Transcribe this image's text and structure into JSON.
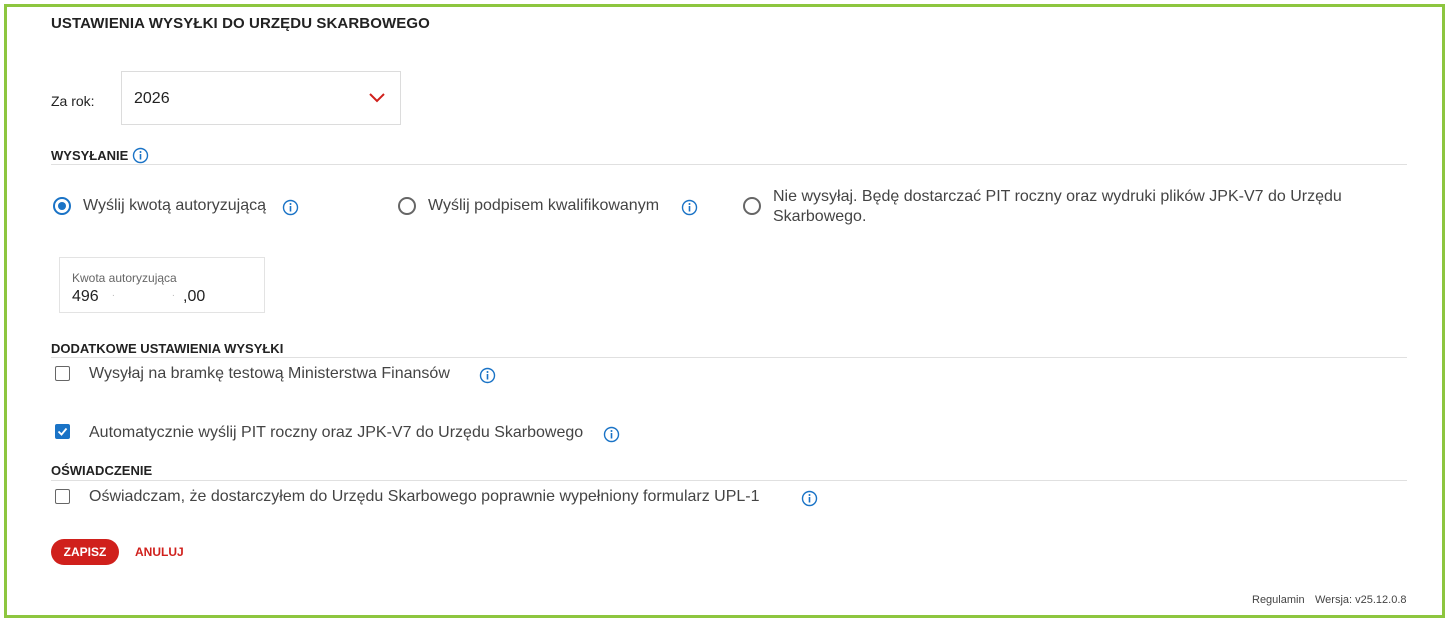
{
  "page": {
    "title": "USTAWIENIA WYSYŁKI DO URZĘDU SKARBOWEGO"
  },
  "year": {
    "label": "Za rok:",
    "value": "2026"
  },
  "sending": {
    "section_label": "WYSYŁANIE",
    "options": [
      {
        "label": "Wyślij kwotą autoryzującą",
        "selected": true
      },
      {
        "label": "Wyślij podpisem kwalifikowanym",
        "selected": false
      },
      {
        "label_line1": "Nie wysyłaj. Będę dostarczać PIT roczny oraz wydruki plików JPK-V7 do Urzędu",
        "label_line2": "Skarbowego.",
        "selected": false
      }
    ]
  },
  "amount": {
    "label": "Kwota autoryzująca",
    "value_part": "496",
    "decimal": ",00",
    "separator": "."
  },
  "extra": {
    "section_label": "DODATKOWE USTAWIENIA WYSYŁKI",
    "items": [
      {
        "label": "Wysyłaj na bramkę testową Ministerstwa Finansów",
        "checked": false
      },
      {
        "label": "Automatycznie wyślij PIT roczny oraz JPK-V7 do Urzędu Skarbowego",
        "checked": true
      }
    ]
  },
  "statement": {
    "section_label": "OŚWIADCZENIE",
    "items": [
      {
        "label": "Oświadczam, że dostarczyłem do Urzędu Skarbowego poprawnie wypełniony formularz UPL-1",
        "checked": false
      }
    ]
  },
  "actions": {
    "save_label": "ZAPISZ",
    "cancel_label": "ANULUJ"
  },
  "footer": {
    "terms": "Regulamin",
    "version": "Wersja: v25.12.0.8"
  },
  "colors": {
    "accent": "#1a73c6",
    "primary": "#d0201c",
    "frame": "#8dc63f"
  }
}
